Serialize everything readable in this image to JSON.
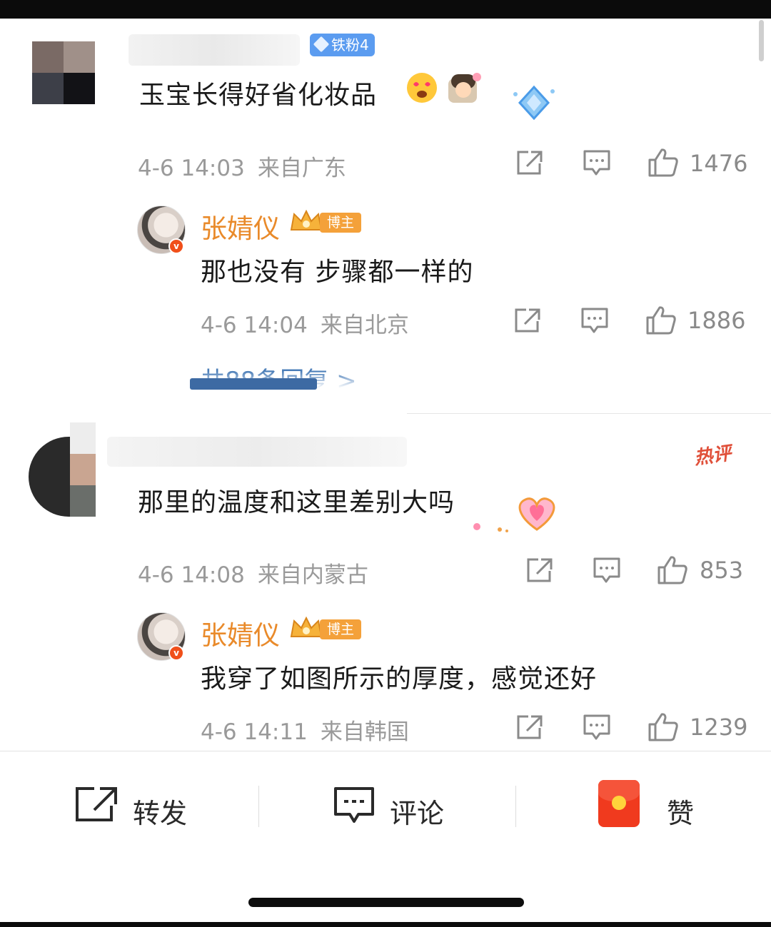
{
  "comments": [
    {
      "badge": "铁粉4",
      "text": "玉宝长得好省化妆品",
      "date": "4-6 14:03",
      "location": "来自广东",
      "likes": "1476",
      "reply": {
        "name": "张婧仪",
        "badge": "博主",
        "text": "那也没有 步骤都一样的",
        "date": "4-6 14:04",
        "location": "来自北京",
        "likes": "1886"
      },
      "more_replies": "共88条回复 >"
    },
    {
      "hot_tag": "热评",
      "text": "那里的温度和这里差别大吗",
      "date": "4-6 14:08",
      "location": "来自内蒙古",
      "likes": "853",
      "reply": {
        "name": "张婧仪",
        "badge": "博主",
        "text": "我穿了如图所示的厚度，感觉还好",
        "date": "4-6 14:11",
        "location": "来自韩国",
        "likes": "1239"
      }
    }
  ],
  "bottom_bar": {
    "repost": "转发",
    "comment": "评论",
    "like": "赞"
  },
  "colors": {
    "blogger_name": "#e98a2a",
    "link": "#4a7db8",
    "meta": "#9a9a9a"
  },
  "icons": [
    "share-icon",
    "comment-icon",
    "thumbs-up-icon",
    "red-packet-icon",
    "diamond-icon",
    "crown-icon"
  ]
}
